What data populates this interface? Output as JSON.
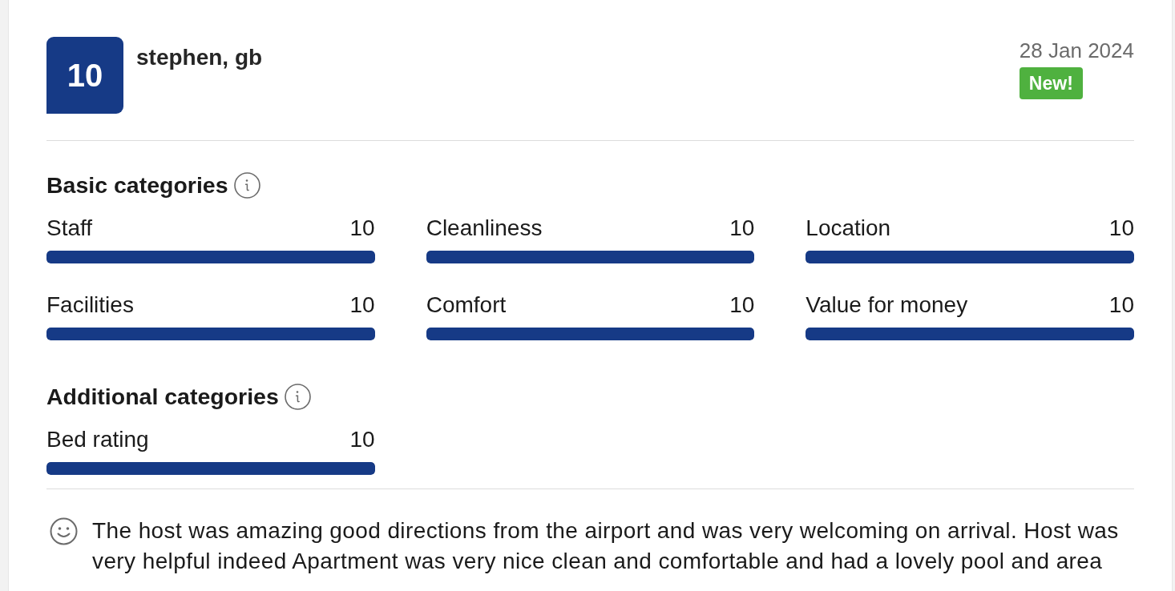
{
  "review": {
    "score": "10",
    "reviewer": "stephen, gb",
    "date": "28 Jan 2024",
    "badge": "New!"
  },
  "category_groups": [
    {
      "title": "Basic categories",
      "items": [
        {
          "label": "Staff",
          "score": "10",
          "level": 1
        },
        {
          "label": "Cleanliness",
          "score": "10",
          "level": 1
        },
        {
          "label": "Location",
          "score": "10",
          "level": 1
        },
        {
          "label": "Facilities",
          "score": "10",
          "level": 1
        },
        {
          "label": "Comfort",
          "score": "10",
          "level": 1
        },
        {
          "label": "Value for money",
          "score": "10",
          "level": 1
        }
      ]
    },
    {
      "title": "Additional categories",
      "items": [
        {
          "label": "Bed rating",
          "score": "10",
          "level": 1
        }
      ]
    }
  ],
  "comment": {
    "text": "The host was amazing good directions from the airport and was very welcoming on arrival. Host was very helpful indeed Apartment was very nice clean and comfortable and had a lovely pool and area"
  }
}
